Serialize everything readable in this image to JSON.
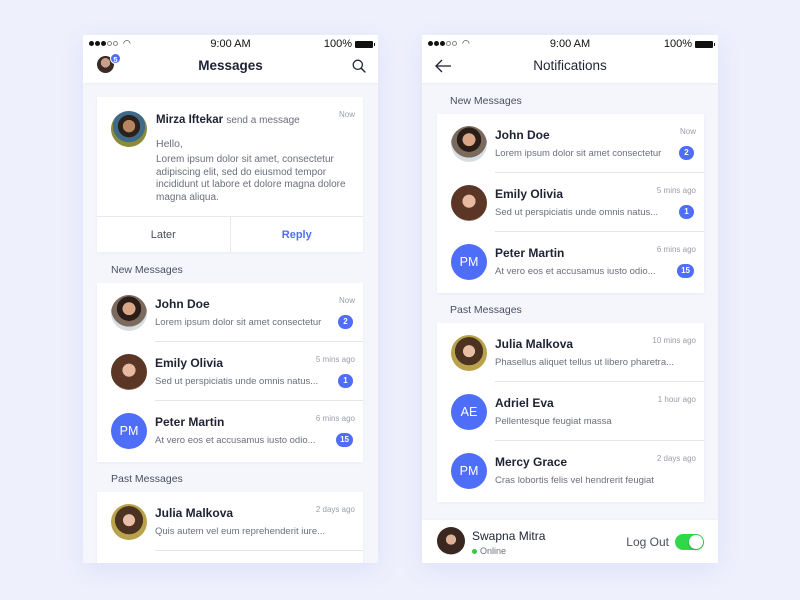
{
  "status_bar": {
    "time": "9:00 AM",
    "battery": "100%"
  },
  "messages_screen": {
    "title": "Messages",
    "avatar_badge": "5",
    "featured": {
      "sender": "Mirza Iftekar",
      "action": "send a message",
      "time": "Now",
      "greeting": "Hello,",
      "body": "Lorem ipsum dolor sit amet, consectetur adipiscing elit, sed do eiusmod tempor incididunt ut labore et dolore magna dolore magna aliqua.",
      "later_label": "Later",
      "reply_label": "Reply"
    },
    "new_section_label": "New Messages",
    "new_messages": [
      {
        "name": "John Doe",
        "preview": "Lorem ipsum dolor sit amet consectetur",
        "time": "Now",
        "badge": "2",
        "avatar": "photo"
      },
      {
        "name": "Emily Olivia",
        "preview": "Sed ut perspiciatis unde omnis natus...",
        "time": "5 mins ago",
        "badge": "1",
        "avatar": "photo"
      },
      {
        "name": "Peter Martin",
        "preview": "At vero eos et accusamus iusto odio...",
        "time": "6 mins ago",
        "badge": "15",
        "initials": "PM"
      }
    ],
    "past_section_label": "Past Messages",
    "past_messages": [
      {
        "name": "Julia Malkova",
        "preview": "Quis autem vel eum reprehenderit iure...",
        "time": "2 days ago",
        "avatar": "photo"
      }
    ]
  },
  "notifications_screen": {
    "title": "Notifications",
    "new_section_label": "New Messages",
    "new_messages": [
      {
        "name": "John Doe",
        "preview": "Lorem ipsum dolor sit amet consectetur",
        "time": "Now",
        "badge": "2"
      },
      {
        "name": "Emily Olivia",
        "preview": "Sed ut perspiciatis unde omnis natus...",
        "time": "5 mins ago",
        "badge": "1"
      },
      {
        "name": "Peter Martin",
        "preview": "At vero eos et accusamus iusto odio...",
        "time": "6 mins ago",
        "badge": "15",
        "initials": "PM"
      }
    ],
    "past_section_label": "Past Messages",
    "past_messages": [
      {
        "name": "Julia Malkova",
        "preview": "Phasellus aliquet tellus ut libero pharetra...",
        "time": "10 mins ago"
      },
      {
        "name": "Adriel Eva",
        "preview": "Pellentesque feugiat massa",
        "time": "1 hour ago",
        "initials": "AE"
      },
      {
        "name": "Mercy Grace",
        "preview": "Cras lobortis felis vel hendrerit feugiat",
        "time": "2 days ago",
        "initials": "PM"
      }
    ],
    "footer": {
      "user_name": "Swapna Mitra",
      "status": "Online",
      "logout_label": "Log Out",
      "logout_toggle_on": true
    }
  },
  "colors": {
    "accent": "#4f6ef7",
    "toggle_on": "#2fd84a",
    "online": "#2ecc40",
    "background": "#eef0fc"
  }
}
